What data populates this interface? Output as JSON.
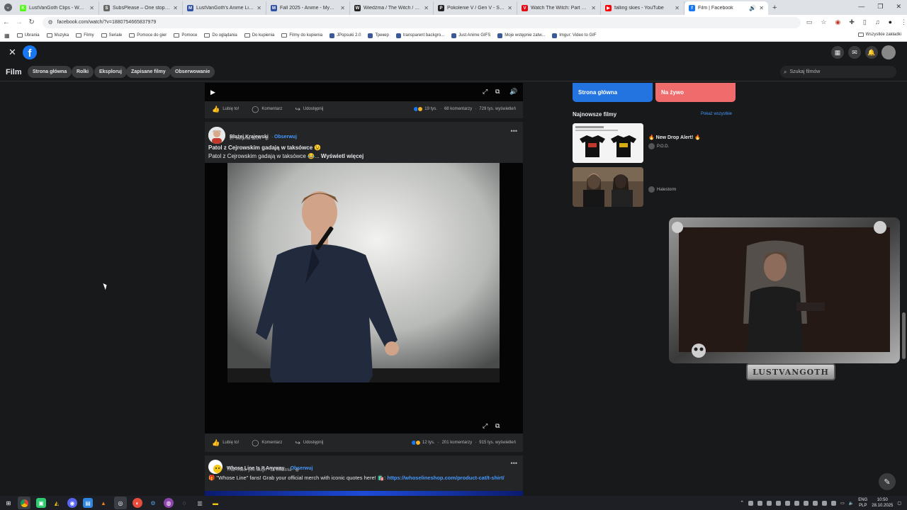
{
  "browser": {
    "tabs": [
      {
        "title": "LustVanGoth Clips - Watch Live",
        "color": "#53fc18",
        "glyph": "K"
      },
      {
        "title": "SubsPlease – One stop shop for",
        "color": "#666666",
        "glyph": "S"
      },
      {
        "title": "LustVanGoth's Anime List - My",
        "color": "#2e51a2",
        "glyph": "M"
      },
      {
        "title": "Fall 2025 - Anime - MyAnimeList",
        "color": "#2e51a2",
        "glyph": "M"
      },
      {
        "title": "Wiedźma / The Witch / Ma-nyeo",
        "color": "#222222",
        "glyph": "W"
      },
      {
        "title": "Pokolenie V / Gen V - Sezon 2",
        "color": "#222222",
        "glyph": "P"
      },
      {
        "title": "Watch The Witch: Part 2. The Ot",
        "color": "#e50914",
        "glyph": "V"
      },
      {
        "title": "falling skies - YouTube",
        "color": "#ff0000",
        "glyph": "▶"
      },
      {
        "title": "Film | Facebook",
        "color": "#1877f2",
        "glyph": "f",
        "active": true
      }
    ],
    "new_tab": "+",
    "url": "facebook.com/watch/?v=1880754665837979",
    "bookmarks": [
      {
        "label": "Ubrania",
        "icon": "folder-icon"
      },
      {
        "label": "Muzyka",
        "icon": "folder-icon"
      },
      {
        "label": "Filmy",
        "icon": "folder-icon"
      },
      {
        "label": "Seriale",
        "icon": "folder-icon"
      },
      {
        "label": "Pomoce do gier",
        "icon": "folder-icon"
      },
      {
        "label": "Pomoce",
        "icon": "folder-icon"
      },
      {
        "label": "Do oglądania",
        "icon": "folder-icon"
      },
      {
        "label": "Do kupienia",
        "icon": "folder-icon"
      },
      {
        "label": "Filmy do kupienia",
        "icon": "folder-icon"
      },
      {
        "label": "JPopsuki 2.0",
        "icon": "site-icon"
      },
      {
        "label": "Трекер",
        "icon": "site-icon"
      },
      {
        "label": "transparent backgro...",
        "icon": "site-icon"
      },
      {
        "label": "Just Anime GIFS",
        "icon": "site-icon"
      },
      {
        "label": "Moje wstępnie zatw...",
        "icon": "site-icon"
      },
      {
        "label": "Imgur: Video to GIF",
        "icon": "site-icon"
      }
    ],
    "all_bookmarks": "Wszystkie zakładki"
  },
  "facebook": {
    "page_title": "Film",
    "watch_tabs": [
      "Strona główna",
      "Rolki",
      "Eksploruj",
      "Zapisane filmy",
      "Obserwowanie"
    ],
    "search_placeholder": "Szukaj filmów",
    "actions": {
      "like": "Lubię to!",
      "comment": "Komentarz",
      "share": "Udostępnij"
    },
    "posts": [
      {
        "reactions": "19 tys.",
        "comments": "68 komentarzy",
        "views": "729 tys. wyświetleń"
      },
      {
        "author": "Błażej Krajewski",
        "follow": "Obserwuj",
        "date": "27 sierpnia 2024",
        "title": "Patol z Cejrowskim gadają w taksówce 😉",
        "body": "Patol z Cejrowskim gadają w taksówce 😂... ",
        "see_more": "Wyświetl więcej",
        "reactions": "12 tys.",
        "comments": "201 komentarzy",
        "views": "915 tys. wyświetleń"
      },
      {
        "author": "Whose Line Is It Anyway",
        "follow": "Obserwuj",
        "subtitle": "That make you laugh",
        "date": "26 kwietnia",
        "body": "🎁 \"Whose Line\" fans! Grab your official merch with iconic quotes here! 🛍️: ",
        "link": "https://whoselineshop.com/product-cat/t-shirt/"
      }
    ],
    "right": {
      "home_button": "Strona główna",
      "live_button": "Na żywo",
      "latest_title": "Najnowsze filmy",
      "see_all": "Pokaż wszystkie",
      "videos": [
        {
          "title": "🔥 New Drop Alert! 🔥",
          "channel": "P.O.D."
        },
        {
          "title": "",
          "channel": "Halestorm"
        }
      ]
    },
    "stream_overlay_label": "LUSTVANGOTH"
  },
  "taskbar": {
    "lang_top": "ENG",
    "lang_bottom": "PLP",
    "time": "10:50",
    "date": "28.10.2025"
  },
  "colors": {
    "fb_blue": "#1877f2",
    "link_blue": "#4599ff",
    "live_red": "#f06b6b",
    "bg": "#18191a",
    "card": "#242526"
  }
}
